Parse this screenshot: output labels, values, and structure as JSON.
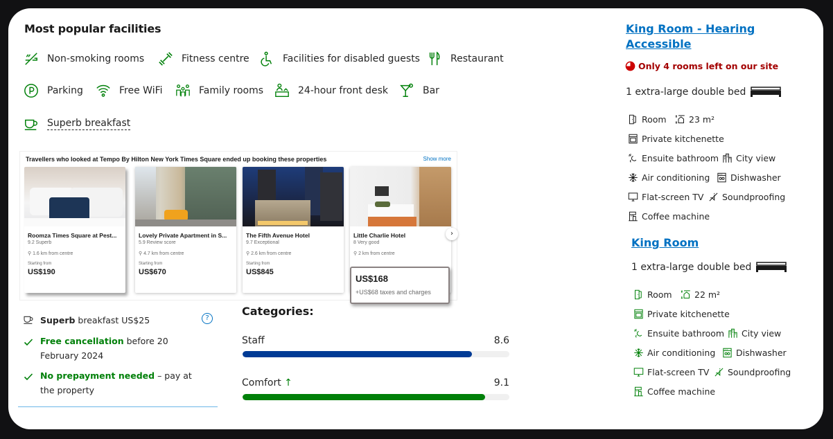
{
  "facilities": {
    "title": "Most popular facilities",
    "items": [
      {
        "label": "Non-smoking rooms",
        "icon": "no-smoking-icon"
      },
      {
        "label": "Fitness centre",
        "icon": "dumbbell-icon"
      },
      {
        "label": "Facilities for disabled guests",
        "icon": "wheelchair-icon"
      },
      {
        "label": "Restaurant",
        "icon": "cutlery-icon"
      },
      {
        "label": "Parking",
        "icon": "parking-icon"
      },
      {
        "label": "Free WiFi",
        "icon": "wifi-icon"
      },
      {
        "label": "Family rooms",
        "icon": "family-icon"
      },
      {
        "label": "24-hour front desk",
        "icon": "front-desk-icon"
      },
      {
        "label": "Bar",
        "icon": "cocktail-icon"
      },
      {
        "label": "Superb breakfast",
        "icon": "coffee-cup-icon"
      }
    ],
    "accent_color": "#008009"
  },
  "recommendations": {
    "title": "Travellers who looked at Tempo By Hilton New York Times Square ended up booking these properties",
    "show_more": "Show more",
    "properties": [
      {
        "name": "Roomza Times Square at Pest...",
        "score": "9.2 Superb",
        "distance": "1.6 km from centre",
        "starting_from": "Starting from",
        "price": "US$190"
      },
      {
        "name": "Lovely Private Apartment in S...",
        "score": "5.9 Review score",
        "distance": "4.7 km from centre",
        "starting_from": "Starting from",
        "price": "US$670"
      },
      {
        "name": "The Fifth Avenue Hotel",
        "score": "9.7 Exceptional",
        "distance": "2.6 km from centre",
        "starting_from": "Starting from",
        "price": "US$845"
      },
      {
        "name": "Little Charlie Hotel",
        "score": "8 Very good",
        "distance": "2 km from centre",
        "price": "US$168",
        "taxes": "+US$68 taxes and charges"
      }
    ],
    "next_label": "›"
  },
  "offer": {
    "breakfast_bold": "Superb",
    "breakfast_rest": " breakfast US$25",
    "help_label": "?",
    "cancellation_bold": "Free cancellation",
    "cancellation_rest": " before 20 February 2024",
    "prepay_bold": "No prepayment needed",
    "prepay_rest": " – pay at the property"
  },
  "categories": {
    "title": "Categories:",
    "max_score": 10,
    "items": [
      {
        "label": "Staff",
        "value": "8.6",
        "score": 8.6,
        "color": "#003b95",
        "trend": ""
      },
      {
        "label": "Comfort",
        "value": "9.1",
        "score": 9.1,
        "color": "#008009",
        "trend": "↑"
      }
    ]
  },
  "rooms": [
    {
      "title": "King Room - Hearing Accessible",
      "scarcity": "Only 4 rooms left on our site",
      "bed": "1 extra-large double bed",
      "amenity_color": "#1a1a1a",
      "size": "23 m²",
      "amenities": {
        "room": "Room",
        "kitchenette": "Private kitchenette",
        "bathroom": "Ensuite bathroom",
        "view": "City view",
        "ac": "Air conditioning",
        "dishwasher": "Dishwasher",
        "tv": "Flat-screen TV",
        "soundproofing": "Soundproofing",
        "coffee": "Coffee machine"
      }
    },
    {
      "title": "King Room",
      "bed": "1 extra-large double bed",
      "amenity_color": "#008009",
      "size": "22 m²",
      "amenities": {
        "room": "Room",
        "kitchenette": "Private kitchenette",
        "bathroom": "Ensuite bathroom",
        "view": "City view",
        "ac": "Air conditioning",
        "dishwasher": "Dishwasher",
        "tv": "Flat-screen TV",
        "soundproofing": "Soundproofing",
        "coffee": "Coffee machine"
      }
    }
  ]
}
